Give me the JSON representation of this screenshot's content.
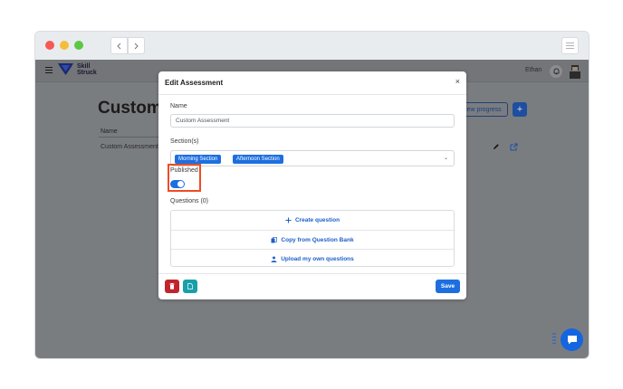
{
  "browser": {
    "back_icon": "chevron-left-icon",
    "forward_icon": "chevron-right-icon",
    "menu_icon": "hamburger-menu-icon"
  },
  "header": {
    "logo_line1": "Skill",
    "logo_line2": "Struck",
    "user_name": "Ethan"
  },
  "page": {
    "title": "Custom",
    "column_name": "Name",
    "row_name": "Custom Assessment",
    "view_progress_label": "iew progress",
    "add_label": "+"
  },
  "modal": {
    "title": "Edit Assessment",
    "close_label": "×",
    "name_label": "Name",
    "name_value": "Custom Assessment",
    "sections_label": "Section(s)",
    "sections": [
      "Morning Section",
      "Afternoon Section"
    ],
    "published_label": "Published",
    "published_on": true,
    "questions_label": "Questions (0)",
    "question_actions": [
      {
        "label": "Create question",
        "icon": "plus-icon"
      },
      {
        "label": "Copy from Question Bank",
        "icon": "copy-icon"
      },
      {
        "label": "Upload my own questions",
        "icon": "upload-user-icon"
      }
    ],
    "save_label": "Save"
  },
  "colors": {
    "primary": "#1d6fe0",
    "danger": "#c0252e",
    "teal": "#19a0a8",
    "highlight": "#ef4b23"
  }
}
